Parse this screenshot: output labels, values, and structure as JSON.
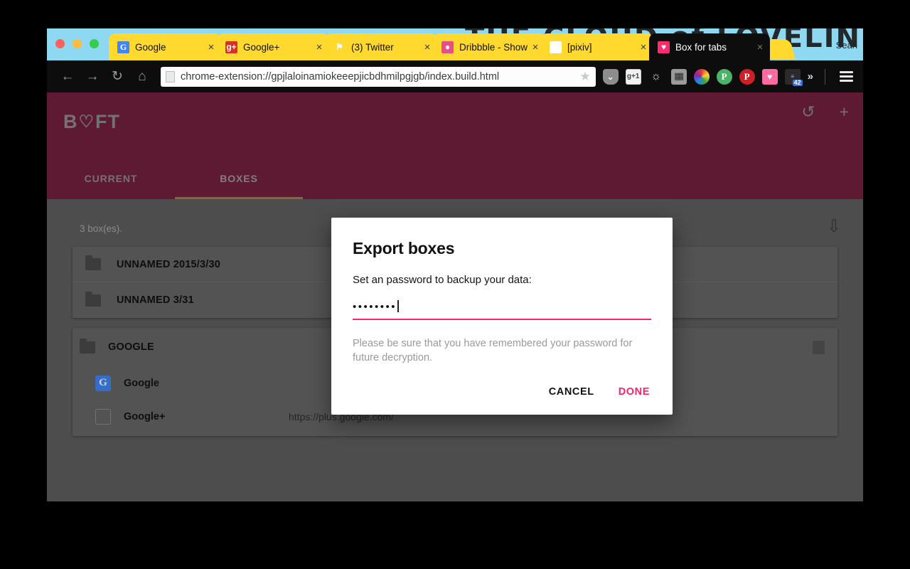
{
  "browser": {
    "profile_name": "Sean",
    "theme_art_text": "THE CLOUD of LOVELINE",
    "new_tab_label": "+",
    "tabs": [
      {
        "title": "Google",
        "favicon": "google-favicon",
        "favicon_glyph": "G",
        "close": "×",
        "active": false
      },
      {
        "title": "Google+",
        "favicon": "gplus-favicon",
        "favicon_glyph": "g+",
        "close": "×",
        "active": false
      },
      {
        "title": "(3) Twitter",
        "favicon": "twitter-favicon",
        "favicon_glyph": "⚑",
        "close": "×",
        "active": false
      },
      {
        "title": "Dribbble - Show",
        "favicon": "dribbble-favicon",
        "favicon_glyph": "●",
        "close": "×",
        "active": false
      },
      {
        "title": "[pixiv]",
        "favicon": "pixiv-favicon",
        "favicon_glyph": "P",
        "close": "×",
        "active": false
      },
      {
        "title": "Box for tabs",
        "favicon": "box-for-tabs-favicon",
        "favicon_glyph": "♥",
        "close": "×",
        "active": true
      }
    ],
    "toolbar": {
      "back_icon": "←",
      "forward_icon": "→",
      "reload_icon": "↻",
      "home_icon": "⌂",
      "url": "chrome-extension://gpjlaloinamiokeeepjicbdhmilpgjgb/index.build.html",
      "bookmark_star": "★",
      "overflow_icon": "»",
      "extensions": [
        {
          "name": "pocket-extension-icon",
          "glyph": "⌄"
        },
        {
          "name": "google-plus-one-extension-icon",
          "glyph": "g+1"
        },
        {
          "name": "notifications-bell-icon",
          "glyph": "🔔"
        },
        {
          "name": "brick-wall-extension-icon",
          "glyph": "▓▓"
        },
        {
          "name": "color-wheel-extension-icon",
          "glyph": ""
        },
        {
          "name": "pushbullet-extension-icon",
          "glyph": "P"
        },
        {
          "name": "pinterest-extension-icon",
          "glyph": "P"
        },
        {
          "name": "box-for-tabs-extension-icon",
          "glyph": "♥"
        },
        {
          "name": "counter-extension-icon",
          "glyph": "≡",
          "badge": "42"
        }
      ]
    }
  },
  "app": {
    "logo": {
      "left": "B",
      "heart": "♡",
      "right": "FT"
    },
    "header_icons": [
      {
        "name": "history-restore-icon",
        "glyph": "↺"
      },
      {
        "name": "add-box-icon",
        "glyph": "+"
      }
    ],
    "tabs": [
      {
        "label": "CURRENT",
        "active": false
      },
      {
        "label": "BOXES",
        "active": true
      }
    ],
    "box_count_text": "3 box(es).",
    "export_icon": "⇩",
    "collapsed_boxes": [
      {
        "title": "UNNAMED 2015/3/30"
      },
      {
        "title": "UNNAMED 3/31"
      }
    ],
    "expanded_box": {
      "title": "GOOGLE",
      "items": [
        {
          "name": "Google",
          "url": "",
          "favicon": "google-favicon",
          "favicon_glyph": "G"
        },
        {
          "name": "Google+",
          "url": "https://plus.google.com/",
          "favicon": "blank-favicon",
          "favicon_glyph": ""
        }
      ]
    }
  },
  "dialog": {
    "title": "Export boxes",
    "label": "Set an password to backup your data:",
    "password_masked": "••••••••",
    "helper": "Please be sure that you have remembered your password for future decryption.",
    "cancel_label": "CANCEL",
    "done_label": "DONE"
  },
  "colors": {
    "accent_pink": "#f5246c",
    "app_header_maroon": "#73203f",
    "tabstrip_blue": "#8fd8f2",
    "tab_yellow": "#ffd92e",
    "content_gray": "#5e5e5e"
  }
}
